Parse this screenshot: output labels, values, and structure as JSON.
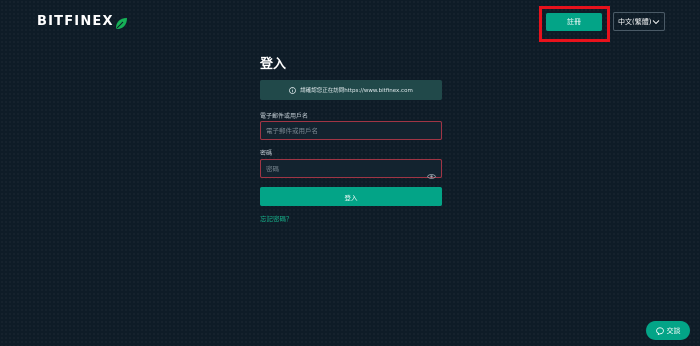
{
  "header": {
    "logo_text": "BITFINEX",
    "register_label": "註冊",
    "language": "中文(繁體)"
  },
  "login": {
    "title": "登入",
    "notice": "請確認您正在訪問https://www.bitfinex.com",
    "email_label": "電子郵件或用戶名",
    "email_placeholder": "電子郵件或用戶名",
    "email_value": "",
    "password_label": "密碼",
    "password_placeholder": "密碼",
    "password_value": "",
    "submit_label": "登入",
    "forgot_link": "忘記密碼？"
  },
  "chat": {
    "label": "交談"
  },
  "colors": {
    "background": "#0e1c27",
    "accent": "#03a487",
    "highlight": "#e8121c"
  },
  "icons": [
    "leaf-icon",
    "chevron-down-icon",
    "info-icon",
    "eye-icon",
    "chat-bubble-icon"
  ]
}
